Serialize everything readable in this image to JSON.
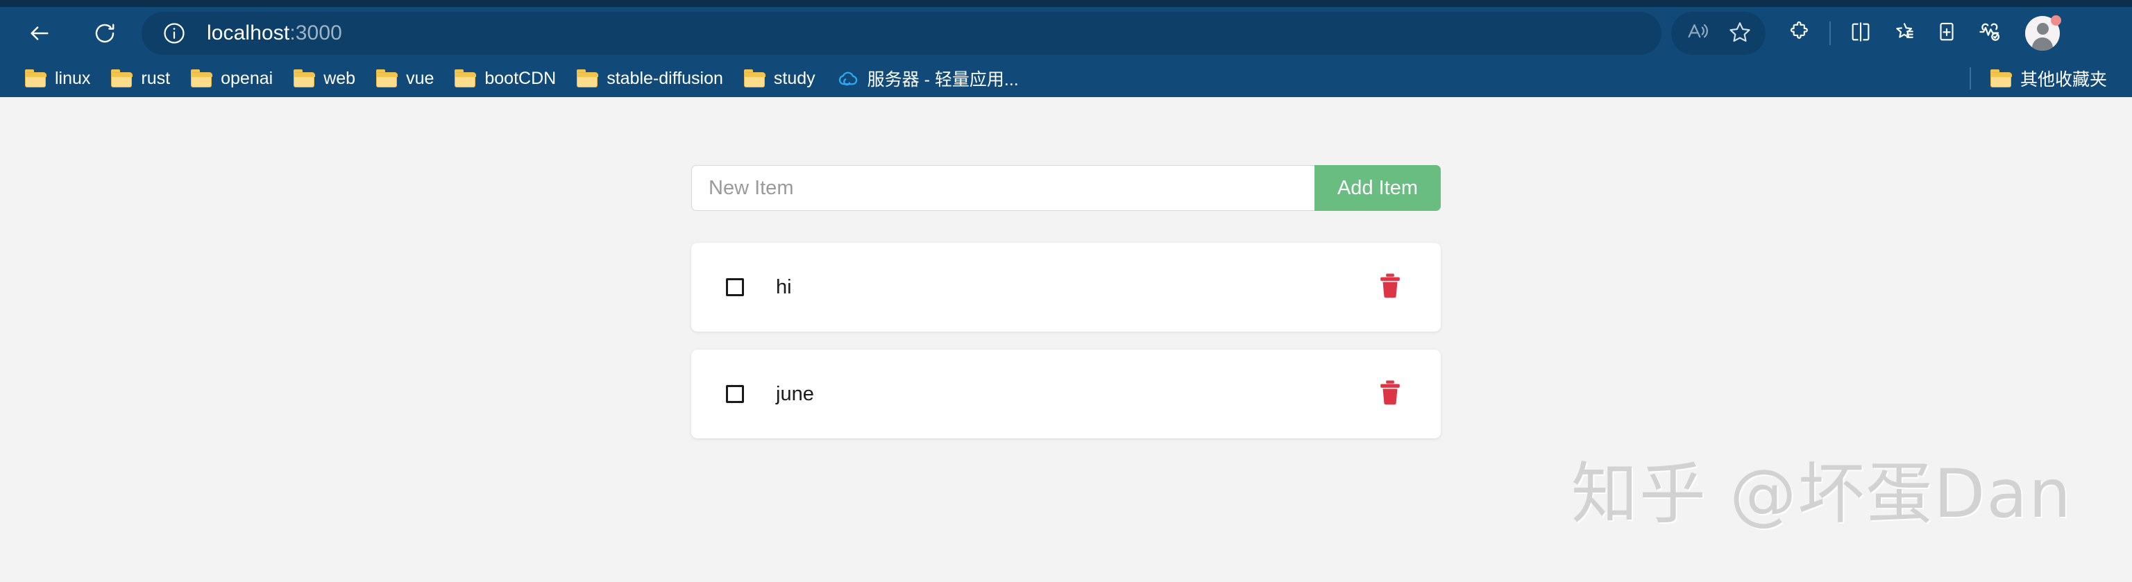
{
  "browser": {
    "nav": {
      "back_icon": "arrow-left-icon",
      "reload_icon": "reload-icon"
    },
    "urlbar": {
      "info_icon": "info-circle-icon",
      "host": "localhost",
      "port": ":3000",
      "full_url": "localhost:3000"
    },
    "toolbar_icons": [
      {
        "name": "read-aloud-icon"
      },
      {
        "name": "favorite-star-icon"
      },
      {
        "name": "extensions-puzzle-icon"
      },
      {
        "name": "split-screen-icon"
      },
      {
        "name": "favorites-list-icon"
      },
      {
        "name": "collections-icon"
      },
      {
        "name": "browser-essentials-icon"
      }
    ],
    "profile": {
      "name": "profile-avatar",
      "notification_dot_color": "#f08c8c"
    },
    "colors": {
      "chrome_blue": "#114a78",
      "urlbar_blue": "#0d3f68",
      "tabstrip_dark": "#0b2f4d"
    }
  },
  "bookmarks": {
    "items": [
      {
        "label": "linux",
        "icon": "folder-icon"
      },
      {
        "label": "rust",
        "icon": "folder-icon"
      },
      {
        "label": "openai",
        "icon": "folder-icon"
      },
      {
        "label": "web",
        "icon": "folder-icon"
      },
      {
        "label": "vue",
        "icon": "folder-icon"
      },
      {
        "label": "bootCDN",
        "icon": "folder-icon"
      },
      {
        "label": "stable-diffusion",
        "icon": "folder-icon"
      },
      {
        "label": "study",
        "icon": "folder-icon"
      },
      {
        "label": "服务器 - 轻量应用...",
        "icon": "tencent-cloud-icon"
      }
    ],
    "other_folder": {
      "label": "其他收藏夹",
      "icon": "folder-icon"
    }
  },
  "app": {
    "input": {
      "placeholder": "New Item",
      "value": ""
    },
    "add_button": {
      "label": "Add Item",
      "color": "#69bd80"
    },
    "todos": [
      {
        "text": "hi",
        "checked": false
      },
      {
        "text": "june",
        "checked": false
      }
    ],
    "delete_icon": {
      "name": "trash-icon",
      "color": "#dc3545"
    },
    "background_color": "#f3f3f3"
  },
  "watermark": {
    "text": "知乎 @坏蛋Dan",
    "color": "#d2d2d2"
  }
}
